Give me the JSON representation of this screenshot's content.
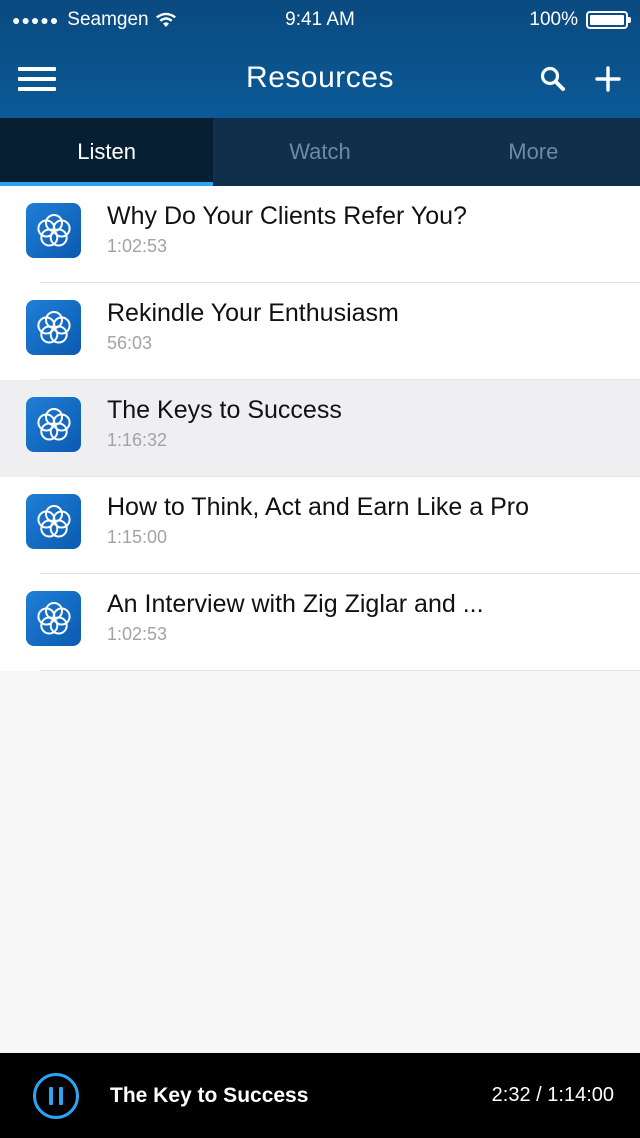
{
  "status_bar": {
    "signal": "●●●●●",
    "carrier": "Seamgen",
    "time": "9:41 AM",
    "battery": "100%"
  },
  "nav": {
    "title": "Resources",
    "menu_icon": "hamburger-menu-icon",
    "search_icon": "search-icon",
    "add_icon": "plus-icon"
  },
  "tabs": [
    {
      "label": "Listen",
      "active": true
    },
    {
      "label": "Watch",
      "active": false
    },
    {
      "label": "More",
      "active": false
    }
  ],
  "items": [
    {
      "title": "Why Do Your Clients Refer You?",
      "duration": "1:02:53",
      "icon": "flower-logo-icon"
    },
    {
      "title": "Rekindle Your Enthusiasm",
      "duration": "56:03",
      "icon": "flower-logo-icon"
    },
    {
      "title": "The Keys to Success",
      "duration": "1:16:32",
      "icon": "flower-logo-icon",
      "highlighted": true
    },
    {
      "title": "How to Think, Act and Earn Like a Pro",
      "duration": "1:15:00",
      "icon": "flower-logo-icon"
    },
    {
      "title": "An Interview with Zig Ziglar and ...",
      "duration": "1:02:53",
      "icon": "flower-logo-icon"
    }
  ],
  "player": {
    "title": "The Key to Success",
    "time": "2:32 / 1:14:00",
    "control_icon": "pause-icon"
  },
  "colors": {
    "header": "#0b5a97",
    "tab_bar": "#0f2f4a",
    "tab_active": "#071f33",
    "accent": "#2ea3ef",
    "player_bg": "#000000"
  }
}
